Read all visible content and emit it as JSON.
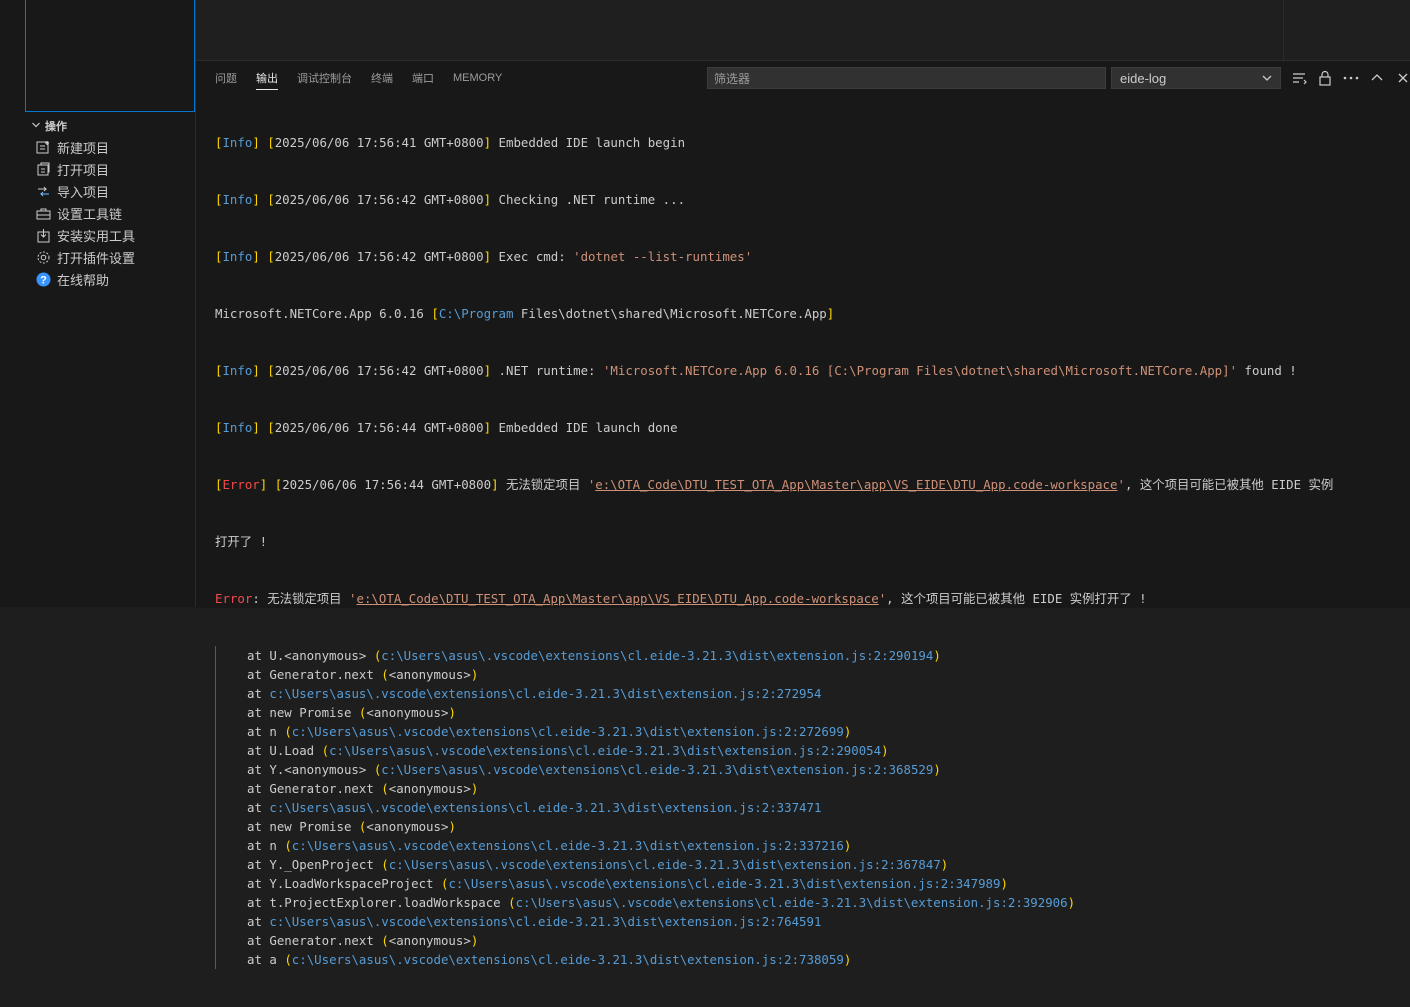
{
  "sidebar": {
    "section_title": "操作",
    "actions": [
      {
        "label": "新建项目",
        "icon": "new-project-icon"
      },
      {
        "label": "打开项目",
        "icon": "open-project-icon"
      },
      {
        "label": "导入项目",
        "icon": "import-project-icon"
      },
      {
        "label": "设置工具链",
        "icon": "toolchain-icon"
      },
      {
        "label": "安装实用工具",
        "icon": "install-tools-icon"
      },
      {
        "label": "打开插件设置",
        "icon": "gear-icon"
      },
      {
        "label": "在线帮助",
        "icon": "help-icon"
      }
    ]
  },
  "panel": {
    "tabs": [
      "问题",
      "输出",
      "调试控制台",
      "终端",
      "端口",
      "MEMORY"
    ],
    "active_tab": "输出",
    "filter_placeholder": "筛选器",
    "channel": "eide-log"
  },
  "log": {
    "l1_level": "Info",
    "l1_time": "2025/06/06 17:56:41 GMT+0800",
    "l1_msg": "Embedded IDE launch begin",
    "l2_level": "Info",
    "l2_time": "2025/06/06 17:56:42 GMT+0800",
    "l2_msg": "Checking .NET runtime ...",
    "l3_level": "Info",
    "l3_time": "2025/06/06 17:56:42 GMT+0800",
    "l3_msg": "Exec cmd: ",
    "l3_str": "'dotnet --list-runtimes'",
    "l4_a": "Microsoft.NETCore.App 6.0.16 ",
    "l4_path": "C:\\Program",
    "l4_b": " Files\\dotnet\\shared\\Microsoft.NETCore.App",
    "l5_level": "Info",
    "l5_time": "2025/06/06 17:56:42 GMT+0800",
    "l5_msg": ".NET runtime: ",
    "l5_str": "'Microsoft.NETCore.App 6.0.16 [C:\\Program Files\\dotnet\\shared\\Microsoft.NETCore.App]'",
    "l5_tail": " found !",
    "l6_level": "Info",
    "l6_time": "2025/06/06 17:56:44 GMT+0800",
    "l6_msg": "Embedded IDE launch done",
    "l7_level": "Error",
    "l7_time": "2025/06/06 17:56:44 GMT+0800",
    "l7_msg": "无法锁定项目 ",
    "l7_q1": "'",
    "l7_path": "e:\\OTA_Code\\DTU_TEST_OTA_App\\Master\\app\\VS_EIDE\\DTU_App.code-workspace",
    "l7_q2": "'",
    "l7_tail": ", 这个项目可能已被其他 EIDE 实例",
    "l7_cont": "打开了 !",
    "l8_label": "Error",
    "l8_msg": ": 无法锁定项目 ",
    "l8_q1": "'",
    "l8_path": "e:\\OTA_Code\\DTU_TEST_OTA_App\\Master\\app\\VS_EIDE\\DTU_App.code-workspace",
    "l8_q2": "'",
    "l8_tail": ", 这个项目可能已被其他 EIDE 实例打开了 !",
    "stack": [
      {
        "fn": "at U.<anonymous> ",
        "loc": "c:\\Users\\asus\\.vscode\\extensions\\cl.eide-3.21.3\\dist\\extension.js:2:290194",
        "paren": true
      },
      {
        "fn": "at Generator.next ",
        "loc": "<anonymous>",
        "paren": true,
        "plain": true
      },
      {
        "fn": "at ",
        "loc": "c:\\Users\\asus\\.vscode\\extensions\\cl.eide-3.21.3\\dist\\extension.js:2:272954",
        "paren": false
      },
      {
        "fn": "at new Promise ",
        "loc": "<anonymous>",
        "paren": true,
        "plain": true
      },
      {
        "fn": "at n ",
        "loc": "c:\\Users\\asus\\.vscode\\extensions\\cl.eide-3.21.3\\dist\\extension.js:2:272699",
        "paren": true
      },
      {
        "fn": "at U.Load ",
        "loc": "c:\\Users\\asus\\.vscode\\extensions\\cl.eide-3.21.3\\dist\\extension.js:2:290054",
        "paren": true
      },
      {
        "fn": "at Y.<anonymous> ",
        "loc": "c:\\Users\\asus\\.vscode\\extensions\\cl.eide-3.21.3\\dist\\extension.js:2:368529",
        "paren": true
      },
      {
        "fn": "at Generator.next ",
        "loc": "<anonymous>",
        "paren": true,
        "plain": true
      },
      {
        "fn": "at ",
        "loc": "c:\\Users\\asus\\.vscode\\extensions\\cl.eide-3.21.3\\dist\\extension.js:2:337471",
        "paren": false
      },
      {
        "fn": "at new Promise ",
        "loc": "<anonymous>",
        "paren": true,
        "plain": true
      },
      {
        "fn": "at n ",
        "loc": "c:\\Users\\asus\\.vscode\\extensions\\cl.eide-3.21.3\\dist\\extension.js:2:337216",
        "paren": true
      },
      {
        "fn": "at Y._OpenProject ",
        "loc": "c:\\Users\\asus\\.vscode\\extensions\\cl.eide-3.21.3\\dist\\extension.js:2:367847",
        "paren": true
      },
      {
        "fn": "at Y.LoadWorkspaceProject ",
        "loc": "c:\\Users\\asus\\.vscode\\extensions\\cl.eide-3.21.3\\dist\\extension.js:2:347989",
        "paren": true
      },
      {
        "fn": "at t.ProjectExplorer.loadWorkspace ",
        "loc": "c:\\Users\\asus\\.vscode\\extensions\\cl.eide-3.21.3\\dist\\extension.js:2:392906",
        "paren": true
      },
      {
        "fn": "at ",
        "loc": "c:\\Users\\asus\\.vscode\\extensions\\cl.eide-3.21.3\\dist\\extension.js:2:764591",
        "paren": false
      },
      {
        "fn": "at Generator.next ",
        "loc": "<anonymous>",
        "paren": true,
        "plain": true
      },
      {
        "fn": "at a ",
        "loc": "c:\\Users\\asus\\.vscode\\extensions\\cl.eide-3.21.3\\dist\\extension.js:2:738059",
        "paren": true
      }
    ]
  },
  "colors": {
    "info": "#569cd6",
    "error": "#f14c4c",
    "string": "#ce9178",
    "bracket": "#ffd700",
    "accent": "#0078d4"
  }
}
